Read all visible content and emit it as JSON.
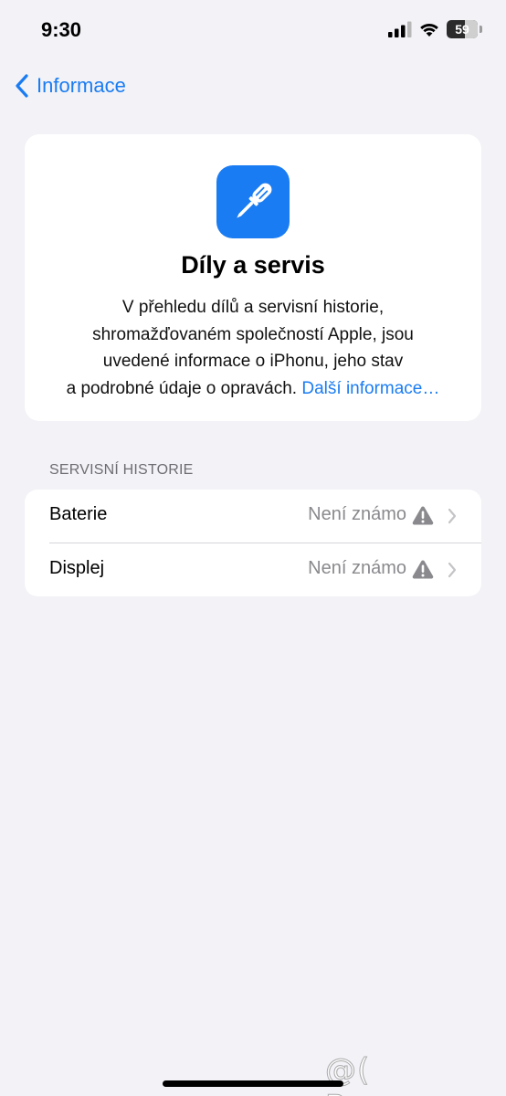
{
  "status_bar": {
    "time": "9:30",
    "battery_level": "59",
    "battery_percent": 59,
    "icons": [
      "signal-icon",
      "wifi-icon",
      "battery-icon"
    ]
  },
  "nav": {
    "back_label": "Informace",
    "back_icon": "chevron-left-icon"
  },
  "info_card": {
    "icon": "screwdriver-icon",
    "title": "Díly a servis",
    "description_lines": [
      "V přehledu dílů a servisní historie,",
      "shromažďovaném společností Apple, jsou",
      "uvedené informace o iPhonu, jeho stav"
    ],
    "description_last": "a podrobné údaje o opravách.",
    "link": "Další informace…"
  },
  "service_history": {
    "header": "SERVISNÍ HISTORIE",
    "rows": [
      {
        "label": "Baterie",
        "value": "Není známo",
        "icon": "warning-icon"
      },
      {
        "label": "Displej",
        "value": "Není známo",
        "icon": "warning-icon"
      }
    ]
  },
  "watermark": "@( Bazos.cz",
  "colors": {
    "accent": "#1a7cf2",
    "background": "#f2f2f7",
    "card": "#ffffff",
    "secondary_text": "#8a8a8e"
  }
}
